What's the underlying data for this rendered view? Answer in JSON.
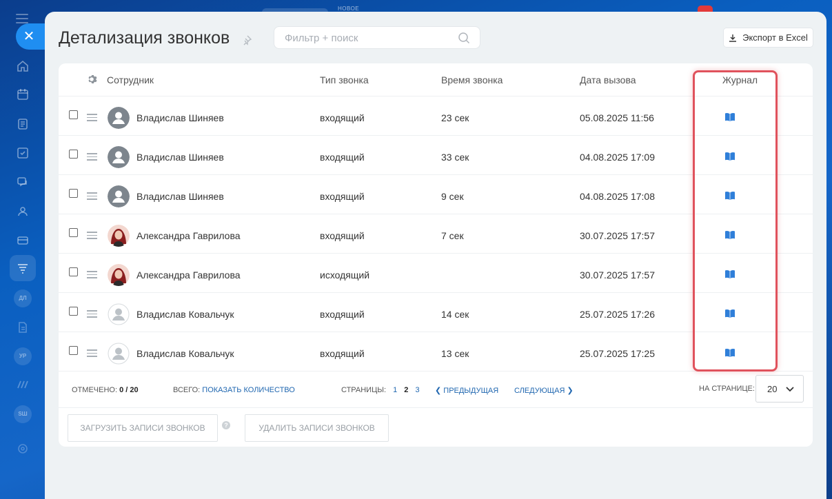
{
  "page": {
    "title": "Детализация звонков",
    "search_placeholder": "Фильтр + поиск",
    "export_label": "Экспорт в Excel"
  },
  "topbar": {
    "new_label": "НОВОЕ"
  },
  "sidebar": {
    "pills": [
      "ДЛ",
      "УР",
      "SШ"
    ]
  },
  "table": {
    "columns": {
      "employee": "Сотрудник",
      "call_type": "Тип звонка",
      "call_time": "Время звонка",
      "call_date": "Дата вызова",
      "journal": "Журнал"
    },
    "rows": [
      {
        "name": "Владислав Шиняев",
        "type": "входящий",
        "duration": "23 сек",
        "date": "05.08.2025 11:56",
        "avatar": "default-dark"
      },
      {
        "name": "Владислав Шиняев",
        "type": "входящий",
        "duration": "33 сек",
        "date": "04.08.2025 17:09",
        "avatar": "default-dark"
      },
      {
        "name": "Владислав Шиняев",
        "type": "входящий",
        "duration": "9 сек",
        "date": "04.08.2025 17:08",
        "avatar": "default-dark"
      },
      {
        "name": "Александра Гаврилова",
        "type": "входящий",
        "duration": "7 сек",
        "date": "30.07.2025 17:57",
        "avatar": "photo"
      },
      {
        "name": "Александра Гаврилова",
        "type": "исходящий",
        "duration": "",
        "date": "30.07.2025 17:57",
        "avatar": "photo"
      },
      {
        "name": "Владислав Ковальчук",
        "type": "входящий",
        "duration": "14 сек",
        "date": "25.07.2025 17:26",
        "avatar": "default-light"
      },
      {
        "name": "Владислав Ковальчук",
        "type": "входящий",
        "duration": "13 сек",
        "date": "25.07.2025 17:25",
        "avatar": "default-light"
      }
    ]
  },
  "footer": {
    "marked_label": "Отмечено:",
    "marked_value": "0 / 20",
    "total_label": "Всего:",
    "total_link": "Показать количество",
    "pages_label": "Страницы:",
    "pages": [
      "1",
      "2",
      "3"
    ],
    "current_page": "2",
    "prev_label": "Предыдущая",
    "next_label": "Следующая",
    "per_page_label": "На странице:",
    "per_page_value": "20"
  },
  "actions": {
    "load_records": "Загрузить записи звонков",
    "delete_records": "Удалить записи звонков",
    "help": "?"
  },
  "colors": {
    "accent_blue": "#1f8ef1",
    "link_blue": "#2067b0",
    "journal_icon": "#2f7fd9",
    "highlight_red": "#e0525c",
    "notification_red": "#e23a3a"
  },
  "icons": {
    "close": "close-icon",
    "pin": "pin-icon",
    "search": "search-icon",
    "download": "download-icon",
    "gear": "gear-icon",
    "journal": "book-icon",
    "chevron": "chevron-down-icon"
  }
}
